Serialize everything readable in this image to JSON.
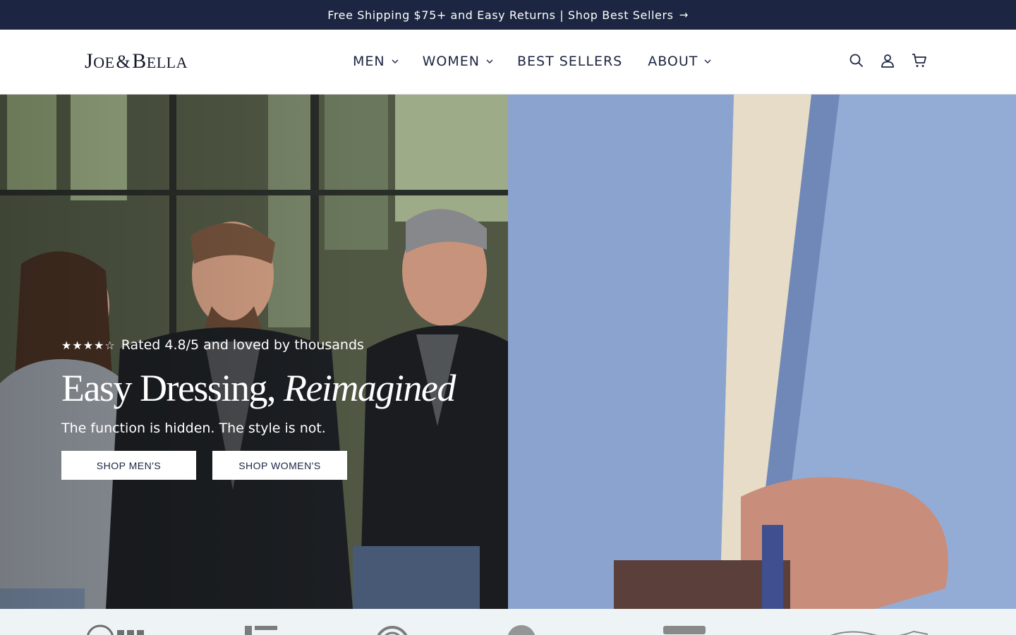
{
  "announcement": {
    "text": "Free Shipping $75+ and Easy Returns | Shop Best Sellers",
    "arrow": "→",
    "background": "#1c2541"
  },
  "header": {
    "logo_text": {
      "part1_cap": "J",
      "part1_rest": "OE",
      "amp": "&",
      "part2_cap": "B",
      "part2_rest": "ELLA"
    },
    "nav": [
      {
        "label": "MEN",
        "has_dropdown": true
      },
      {
        "label": "WOMEN",
        "has_dropdown": true
      },
      {
        "label": "BEST SELLERS",
        "has_dropdown": false
      },
      {
        "label": "ABOUT",
        "has_dropdown": true
      }
    ],
    "icons": [
      "search-icon",
      "account-icon",
      "cart-icon"
    ],
    "text_color": "#1c2541"
  },
  "hero": {
    "stars": "★★★★☆",
    "rating_text": "Rated 4.8/5 and loved by thousands",
    "title_main": "Easy Dressing,",
    "title_italic": "Reimagined",
    "subtitle": "The function is hidden. The style is not.",
    "cta_men": "SHOP MEN'S",
    "cta_women": "SHOP WOMEN'S"
  },
  "press_strip": {
    "background": "#eef4f5",
    "logos": [
      "pbs-logo",
      "magazine-logo",
      "circle-logo",
      "badge-logo",
      "good-housekeeping-logo",
      "script-logo"
    ]
  }
}
